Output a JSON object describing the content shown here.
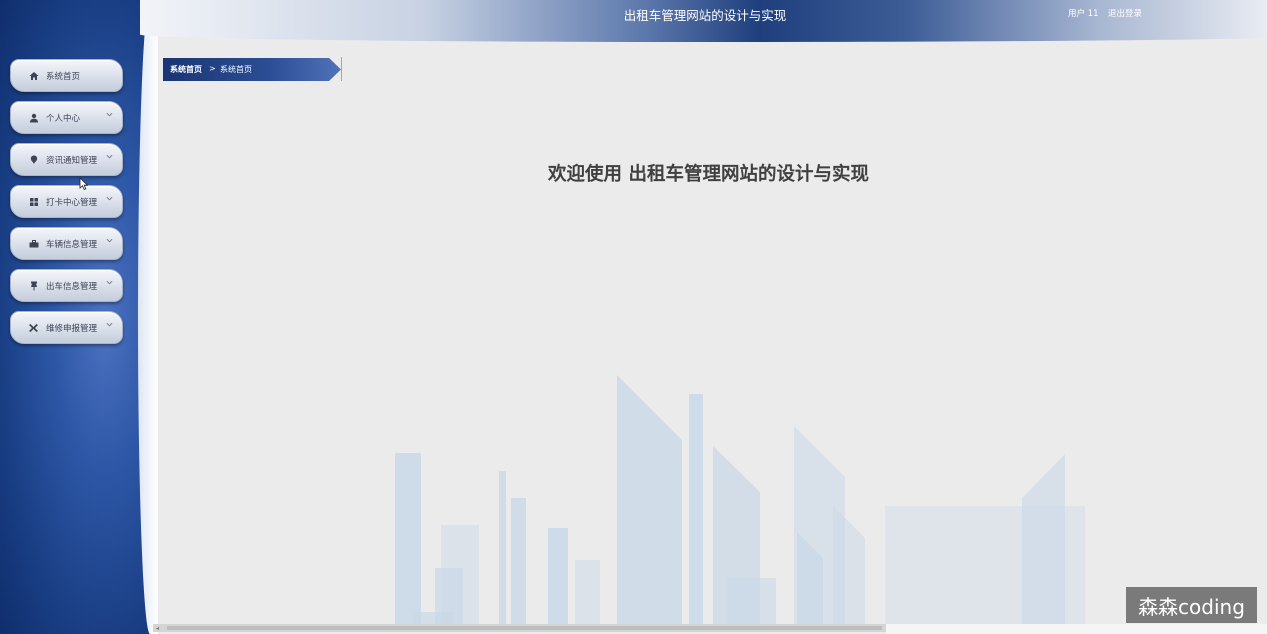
{
  "header": {
    "title": "出租车管理网站的设计与实现",
    "user_label": "用户 11",
    "logout_label": "退出登录"
  },
  "breadcrumb": {
    "root": "系统首页",
    "separator": ">",
    "current": "系统首页"
  },
  "sidebar": {
    "items": [
      {
        "label": "系统首页",
        "icon": "home-icon",
        "has_chevron": false
      },
      {
        "label": "个人中心",
        "icon": "user-icon",
        "has_chevron": true
      },
      {
        "label": "资讯通知管理",
        "icon": "pin-icon",
        "has_chevron": true
      },
      {
        "label": "打卡中心管理",
        "icon": "grid-icon",
        "has_chevron": true
      },
      {
        "label": "车辆信息管理",
        "icon": "briefcase-icon",
        "has_chevron": true
      },
      {
        "label": "出车信息管理",
        "icon": "thumbtack-icon",
        "has_chevron": true
      },
      {
        "label": "维修申报管理",
        "icon": "tools-icon",
        "has_chevron": true
      }
    ]
  },
  "main": {
    "welcome": "欢迎使用 出租车管理网站的设计与实现"
  },
  "watermark": "森森coding",
  "colors": {
    "sidebar_blue": "#1a3f85",
    "accent": "#2d57a6",
    "skyline": "#c7d6e6"
  }
}
